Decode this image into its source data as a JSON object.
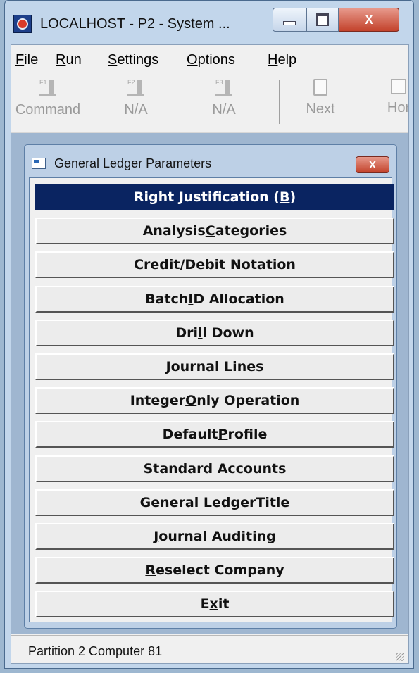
{
  "window": {
    "title": "LOCALHOST - P2 - System ...",
    "close_glyph": "X"
  },
  "menubar": {
    "items": [
      {
        "label": "File",
        "mnemonic_index": 0
      },
      {
        "label": "Run",
        "mnemonic_index": 0
      },
      {
        "label": "Settings",
        "mnemonic_index": 0
      },
      {
        "label": "Options",
        "mnemonic_index": 0
      },
      {
        "label": "Help",
        "mnemonic_index": 0
      }
    ]
  },
  "toolbar": {
    "buttons": [
      {
        "key": "F1",
        "label": "Command",
        "icon": "key-icon",
        "enabled": false
      },
      {
        "key": "F2",
        "label": "N/A",
        "icon": "key-icon",
        "enabled": false
      },
      {
        "key": "F3",
        "label": "N/A",
        "icon": "key-icon",
        "enabled": false
      },
      {
        "key": "",
        "label": "Next",
        "icon": "document-icon",
        "enabled": false
      },
      {
        "key": "",
        "label": "Hor",
        "icon": "home-icon",
        "enabled": false
      }
    ]
  },
  "dialog": {
    "title": "General Ledger Parameters",
    "close_glyph": "X",
    "options": [
      {
        "text": "Right Justification (B)",
        "underline_index": 21,
        "selected": true
      },
      {
        "text": "Analysis Categories",
        "underline_index": 9,
        "selected": false
      },
      {
        "text": "Credit/Debit Notation",
        "underline_index": 7,
        "selected": false
      },
      {
        "text": "Batch ID Allocation",
        "underline_index": 6,
        "selected": false
      },
      {
        "text": "Drill Down",
        "underline_index": 3,
        "selected": false
      },
      {
        "text": "Journal Lines",
        "underline_index": 4,
        "selected": false
      },
      {
        "text": "Integer Only Operation",
        "underline_index": 8,
        "selected": false
      },
      {
        "text": "Default Profile",
        "underline_index": 8,
        "selected": false
      },
      {
        "text": "Standard Accounts",
        "underline_index": 0,
        "selected": false
      },
      {
        "text": "General Ledger Title",
        "underline_index": 15,
        "selected": false
      },
      {
        "text": "Journal Auditing",
        "underline_index": 0,
        "selected": false
      },
      {
        "text": "Reselect Company",
        "underline_index": 0,
        "selected": false
      },
      {
        "text": "Exit",
        "underline_index": 1,
        "selected": false
      }
    ]
  },
  "statusbar": {
    "text": "Partition 2 Computer 81"
  },
  "colors": {
    "selected_bg": "#0a2461",
    "selected_fg": "#ffffff",
    "button_bg": "#ececec"
  }
}
